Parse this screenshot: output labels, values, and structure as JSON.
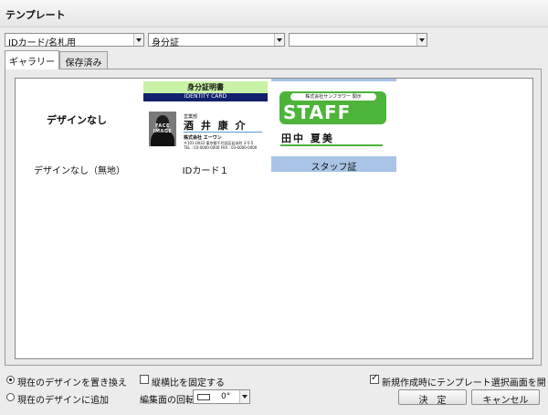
{
  "window": {
    "title": "テンプレート"
  },
  "filters": {
    "category": "IDカード/名札用",
    "subcategory": "身分証",
    "third": ""
  },
  "tabs": [
    {
      "label": "ギャラリー",
      "active": true
    },
    {
      "label": "保存済み",
      "active": false
    }
  ],
  "gallery": {
    "items": [
      {
        "preview_text": "デザインなし",
        "caption": "デザインなし（無地）"
      },
      {
        "caption": "IDカード１",
        "card": {
          "header": "身分証明書",
          "subheader": "IDENTITY CARD",
          "photo_stamp": "FACE IMAGE",
          "role": "営業部",
          "name": "酒 井  康 介",
          "company": "株式会社 エーワン",
          "address": "〒101-0032 東京都千代田区岩本町 3-5-5",
          "tel": "TEL : 03-0000-0000  FAX : 03-0000-0000"
        }
      },
      {
        "caption": "スタッフ証",
        "selected": true,
        "card": {
          "company": "株式会社サンフラワー 関示",
          "badge": "STAFF",
          "name": "田中   夏美"
        }
      }
    ]
  },
  "options": {
    "replace_label": "現在のデザインを置き換え",
    "replace_selected": true,
    "append_label": "現在のデザインに追加",
    "append_selected": false,
    "lock_ratio_label": "縦横比を固定する",
    "lock_ratio_checked": false,
    "rotation_label": "編集面の回転",
    "rotation_value": "0°",
    "open_on_new_label": "新規作成時にテンプレート選択画面を開く",
    "open_on_new_checked": true
  },
  "buttons": {
    "ok": "決　定",
    "cancel": "キャンセル"
  },
  "colors": {
    "selection": "#a9c4e6",
    "staff_green": "#4db43a",
    "id_header_green": "#c8f2a6",
    "id_bar_navy": "#12206e"
  }
}
